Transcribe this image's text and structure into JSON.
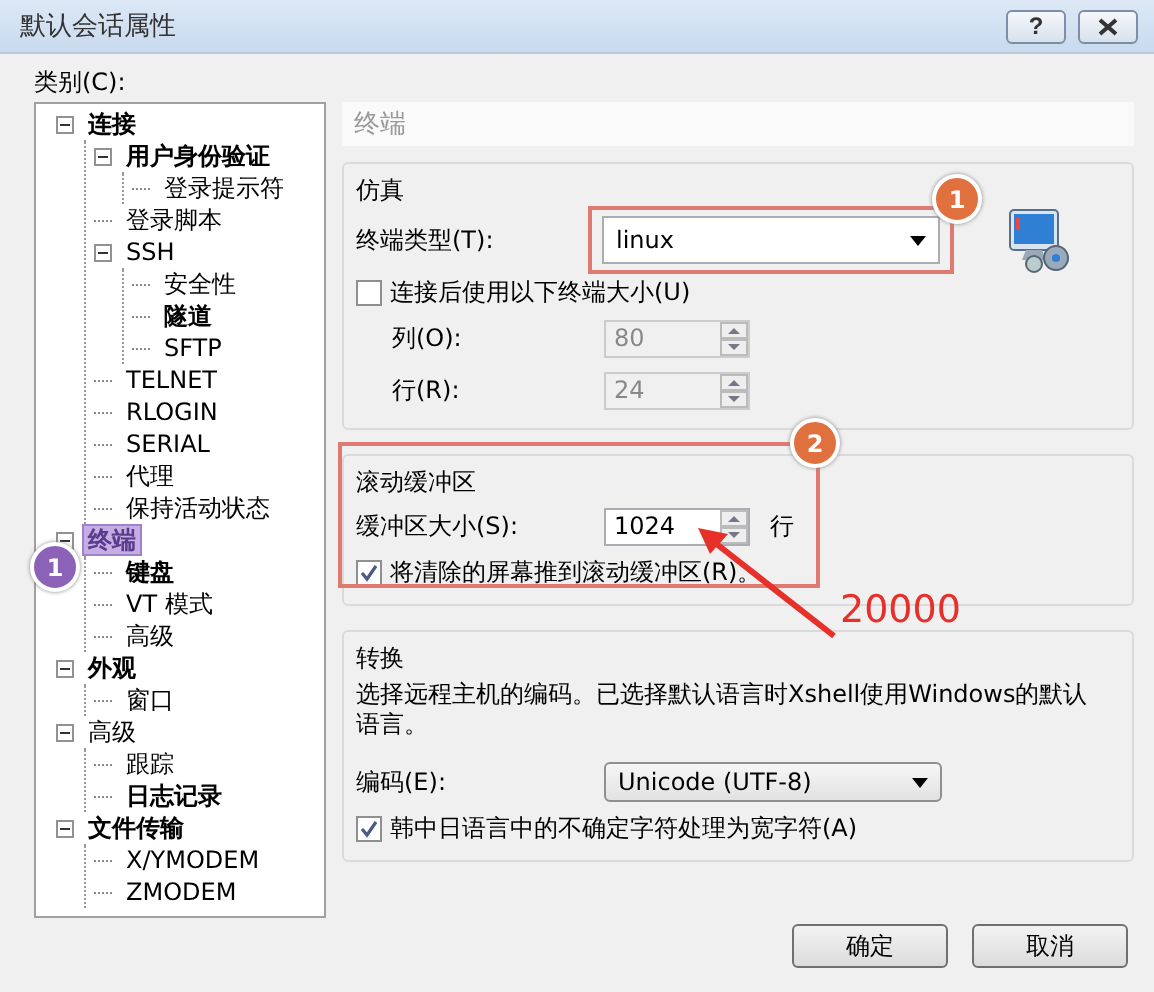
{
  "window": {
    "title": "默认会话属性",
    "controls": [
      {
        "kind": "help",
        "label": "?"
      },
      {
        "kind": "close"
      }
    ]
  },
  "category_label": "类别(C):",
  "tree": [
    {
      "label": "连接",
      "bold": true,
      "selected": false,
      "expanded": true,
      "children": [
        {
          "label": "用户身份验证",
          "bold": true,
          "selected": false,
          "expanded": true,
          "children": [
            {
              "label": "登录提示符",
              "bold": false,
              "selected": false
            }
          ]
        },
        {
          "label": "登录脚本",
          "bold": false,
          "selected": false
        },
        {
          "label": "SSH",
          "bold": false,
          "selected": false,
          "expanded": true,
          "children": [
            {
              "label": "安全性",
              "bold": false,
              "selected": false
            },
            {
              "label": "隧道",
              "bold": true,
              "selected": false
            },
            {
              "label": "SFTP",
              "bold": false,
              "selected": false
            }
          ]
        },
        {
          "label": "TELNET",
          "bold": false,
          "selected": false
        },
        {
          "label": "RLOGIN",
          "bold": false,
          "selected": false
        },
        {
          "label": "SERIAL",
          "bold": false,
          "selected": false
        },
        {
          "label": "代理",
          "bold": false,
          "selected": false
        },
        {
          "label": "保持活动状态",
          "bold": false,
          "selected": false
        }
      ]
    },
    {
      "label": "终端",
      "bold": true,
      "selected": true,
      "expanded": true,
      "badge": "1",
      "children": [
        {
          "label": "键盘",
          "bold": true,
          "selected": false
        },
        {
          "label": "VT 模式",
          "bold": false,
          "selected": false
        },
        {
          "label": "高级",
          "bold": false,
          "selected": false
        }
      ]
    },
    {
      "label": "外观",
      "bold": true,
      "selected": false,
      "expanded": true,
      "children": [
        {
          "label": "窗口",
          "bold": false,
          "selected": false
        }
      ]
    },
    {
      "label": "高级",
      "bold": false,
      "selected": false,
      "expanded": true,
      "children": [
        {
          "label": "跟踪",
          "bold": false,
          "selected": false
        },
        {
          "label": "日志记录",
          "bold": true,
          "selected": false
        }
      ]
    },
    {
      "label": "文件传输",
      "bold": true,
      "selected": false,
      "expanded": true,
      "children": [
        {
          "label": "X/YMODEM",
          "bold": false,
          "selected": false
        },
        {
          "label": "ZMODEM",
          "bold": false,
          "selected": false
        }
      ]
    }
  ],
  "panel": {
    "title": "终端",
    "emulation": {
      "title": "仿真",
      "terminal_type": {
        "label": "终端类型(T):",
        "value": "linux",
        "badge": "1"
      },
      "use_size": {
        "label": "连接后使用以下终端大小(U)",
        "checked": false
      },
      "columns": {
        "label": "列(O):",
        "value": "80"
      },
      "rows": {
        "label": "行(R):",
        "value": "24"
      }
    },
    "scrollback": {
      "title": "滚动缓冲区",
      "badge": "2",
      "size": {
        "label": "缓冲区大小(S):",
        "value": "1024",
        "unit": "行"
      },
      "push_cleared": {
        "label": "将清除的屏幕推到滚动缓冲区(R)。",
        "checked": true
      },
      "note": "20000"
    },
    "translation": {
      "title": "转换",
      "description": "选择远程主机的编码。已选择默认语言时Xshell使用Windows的默认语言。",
      "encoding": {
        "label": "编码(E):",
        "value": "Unicode (UTF-8)"
      },
      "cjk_wide": {
        "label": "韩中日语言中的不确定字符处理为宽字符(A)",
        "checked": true
      }
    }
  },
  "buttons": [
    "确定",
    "取消"
  ]
}
